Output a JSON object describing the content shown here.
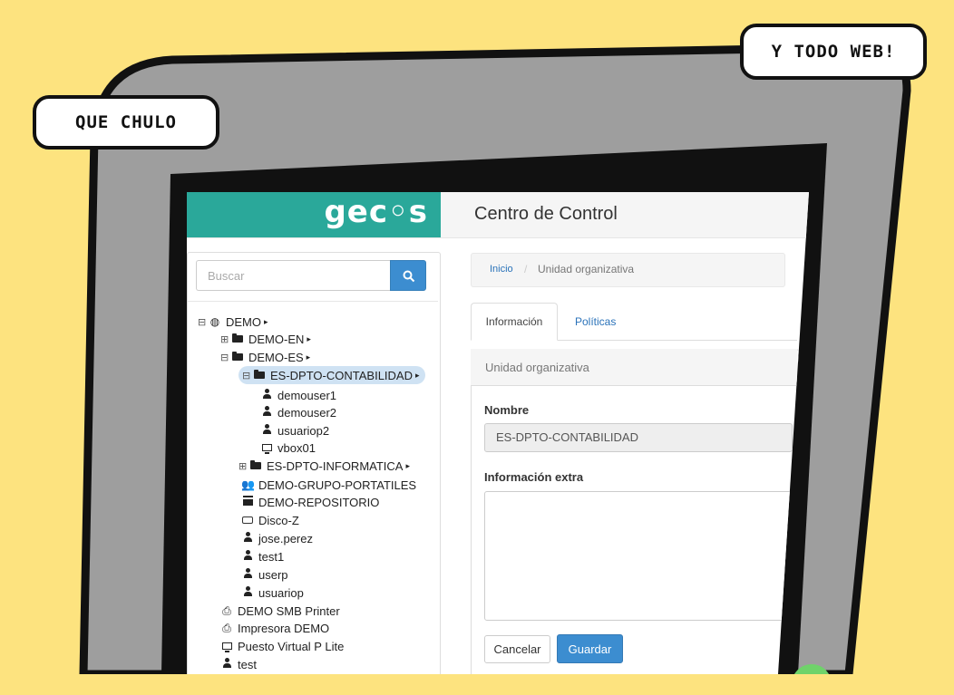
{
  "comic": {
    "bubble_left": "QUE CHULO",
    "bubble_right": "Y TODO WEB!"
  },
  "app": {
    "logo": "gec◦s",
    "title": "Centro de Control"
  },
  "search": {
    "placeholder": "Buscar",
    "icon": "search-icon"
  },
  "tree": [
    {
      "label": "DEMO",
      "icon": "globe-icon",
      "toggle": "⊟",
      "caret": true
    },
    {
      "label": "DEMO-EN",
      "icon": "folder-icon",
      "toggle": "⊞",
      "caret": true
    },
    {
      "label": "DEMO-ES",
      "icon": "folder-icon",
      "toggle": "⊟",
      "caret": true
    },
    {
      "label": "ES-DPTO-CONTABILIDAD",
      "icon": "folder-icon",
      "toggle": "⊟",
      "caret": true,
      "selected": true
    },
    {
      "label": "demouser1",
      "icon": "user-icon"
    },
    {
      "label": "demouser2",
      "icon": "user-icon"
    },
    {
      "label": "usuariop2",
      "icon": "user-icon"
    },
    {
      "label": "vbox01",
      "icon": "monitor-icon"
    },
    {
      "label": "ES-DPTO-INFORMATICA",
      "icon": "folder-icon",
      "toggle": "⊞",
      "caret": true
    },
    {
      "label": "DEMO-GRUPO-PORTATILES",
      "icon": "group-icon"
    },
    {
      "label": "DEMO-REPOSITORIO",
      "icon": "archive-icon"
    },
    {
      "label": "Disco-Z",
      "icon": "drive-icon"
    },
    {
      "label": "jose.perez",
      "icon": "user-icon"
    },
    {
      "label": "test1",
      "icon": "user-icon"
    },
    {
      "label": "userp",
      "icon": "user-icon"
    },
    {
      "label": "usuariop",
      "icon": "user-icon"
    },
    {
      "label": "DEMO SMB Printer",
      "icon": "printer-icon"
    },
    {
      "label": "Impresora DEMO",
      "icon": "printer-icon"
    },
    {
      "label": "Puesto Virtual P Lite",
      "icon": "monitor-icon"
    },
    {
      "label": "test",
      "icon": "user-icon"
    }
  ],
  "breadcrumb": {
    "home": "Inicio",
    "separator": "/",
    "current": "Unidad organizativa"
  },
  "tabs": {
    "info": "Información",
    "policies": "Políticas"
  },
  "panel": {
    "title": "Unidad organizativa",
    "name_label": "Nombre",
    "name_value": "ES-DPTO-CONTABILIDAD",
    "extra_label": "Información extra",
    "extra_value": ""
  },
  "buttons": {
    "cancel": "Cancelar",
    "save": "Guardar"
  }
}
